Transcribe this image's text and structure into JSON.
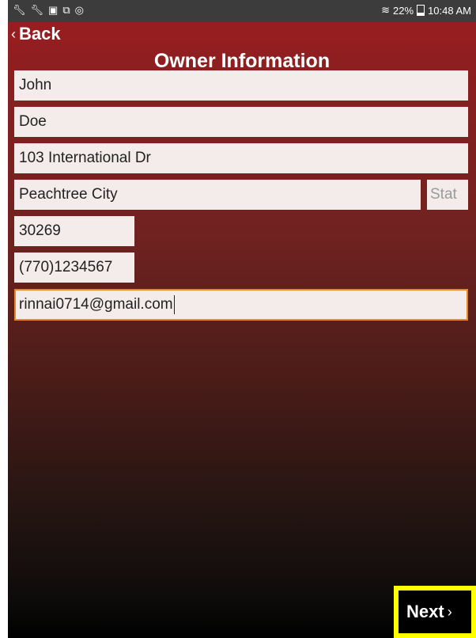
{
  "status_bar": {
    "left_icons": [
      "wrench-icon",
      "wrench-icon",
      "image-icon",
      "cast-icon",
      "sync-icon"
    ],
    "wifi_icon": "wifi-icon",
    "battery": "22%",
    "time": "10:48 AM"
  },
  "nav": {
    "back_label": "Back",
    "back_icon": "chevron-left-icon"
  },
  "page": {
    "title": "Owner Information"
  },
  "form": {
    "first_name": "John",
    "last_name": "Doe",
    "address": "103 International Dr",
    "city": "Peachtree City",
    "state_placeholder": "Stat",
    "zip": "30269",
    "phone": "(770)1234567",
    "email": "rinnai0714@gmail.com"
  },
  "footer": {
    "next_label": "Next",
    "next_icon": "chevron-right-icon",
    "highlight_color": "#ffff00"
  },
  "colors": {
    "header_red": "#9e1c20",
    "focus_orange": "#e8862a",
    "field_bg": "#f3eceb"
  }
}
